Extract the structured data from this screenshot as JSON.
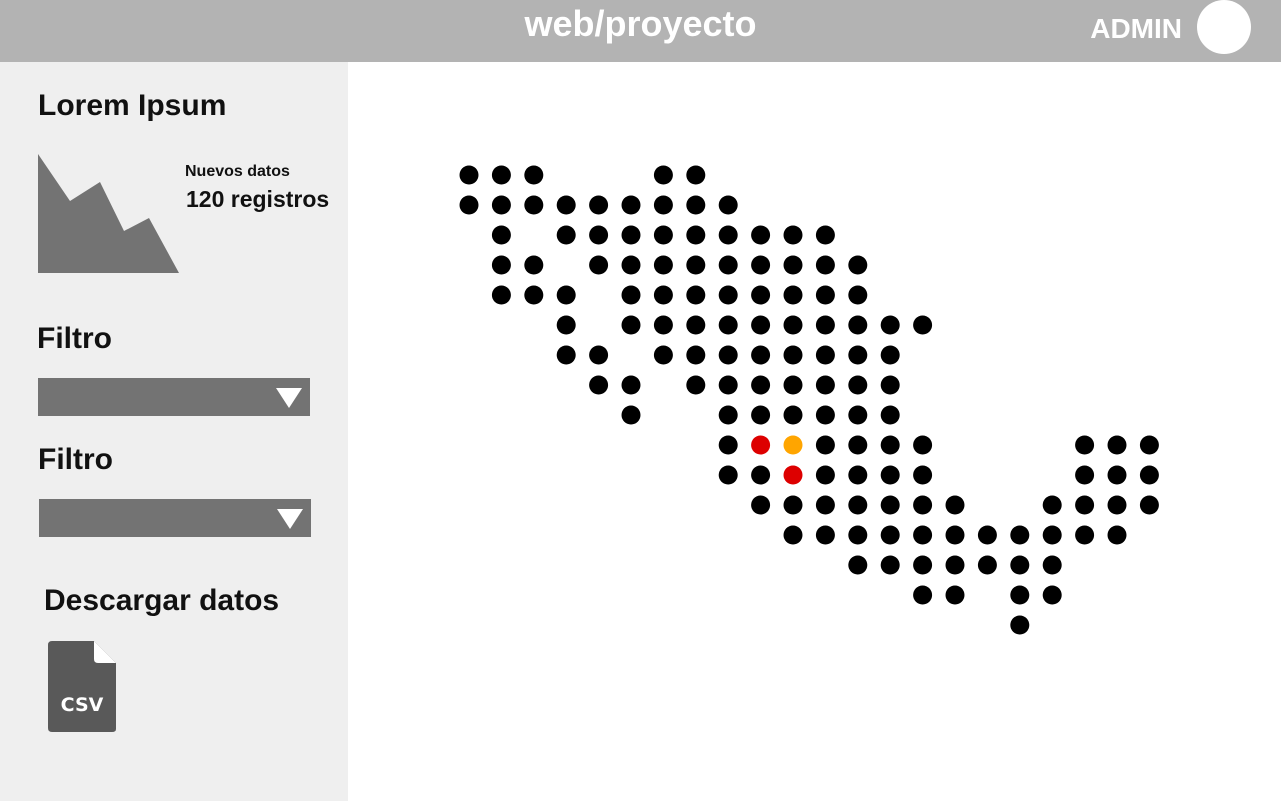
{
  "header": {
    "title": "web/proyecto",
    "user_label": "ADMIN"
  },
  "sidebar": {
    "summary_title": "Lorem Ipsum",
    "new_data_caption": "Nuevos datos",
    "new_data_value": "120 registros",
    "filters": [
      {
        "label": "Filtro",
        "selected": ""
      },
      {
        "label": "Filtro",
        "selected": ""
      }
    ],
    "download_title": "Descargar datos",
    "download_file_label": "CSV"
  },
  "map": {
    "colors": {
      "default": "#000000",
      "highlight_red": "#dd0000",
      "highlight_orange": "#ffa500"
    },
    "rows": [
      {
        "cols": [
          0,
          1,
          2,
          6,
          7
        ]
      },
      {
        "cols": [
          0,
          1,
          2,
          3,
          4,
          5,
          6,
          7,
          8
        ]
      },
      {
        "cols": [
          1,
          3,
          4,
          5,
          6,
          7,
          8,
          9,
          10,
          11
        ]
      },
      {
        "cols": [
          1,
          2,
          4,
          5,
          6,
          7,
          8,
          9,
          10,
          11,
          12
        ]
      },
      {
        "cols": [
          1,
          2,
          3,
          5,
          6,
          7,
          8,
          9,
          10,
          11,
          12
        ]
      },
      {
        "cols": [
          3,
          5,
          6,
          7,
          8,
          9,
          10,
          11,
          12,
          13,
          14
        ]
      },
      {
        "cols": [
          3,
          4,
          6,
          7,
          8,
          9,
          10,
          11,
          12,
          13
        ]
      },
      {
        "cols": [
          4,
          5,
          7,
          8,
          9,
          10,
          11,
          12,
          13
        ]
      },
      {
        "cols": [
          5,
          8,
          9,
          10,
          11,
          12,
          13
        ]
      },
      {
        "cols": [
          8,
          9,
          10,
          11,
          12,
          13,
          14,
          19,
          20,
          21
        ],
        "red": [
          9
        ],
        "orange": [
          10
        ]
      },
      {
        "cols": [
          8,
          9,
          10,
          11,
          12,
          13,
          14,
          19,
          20,
          21
        ],
        "red": [
          10
        ]
      },
      {
        "cols": [
          9,
          10,
          11,
          12,
          13,
          14,
          15,
          18,
          19,
          20,
          21
        ]
      },
      {
        "cols": [
          10,
          11,
          12,
          13,
          14,
          15,
          16,
          17,
          18,
          19,
          20
        ]
      },
      {
        "cols": [
          12,
          13,
          14,
          15,
          16,
          17,
          18
        ]
      },
      {
        "cols": [
          14,
          15,
          17,
          18
        ]
      },
      {
        "cols": [
          17
        ]
      }
    ]
  }
}
